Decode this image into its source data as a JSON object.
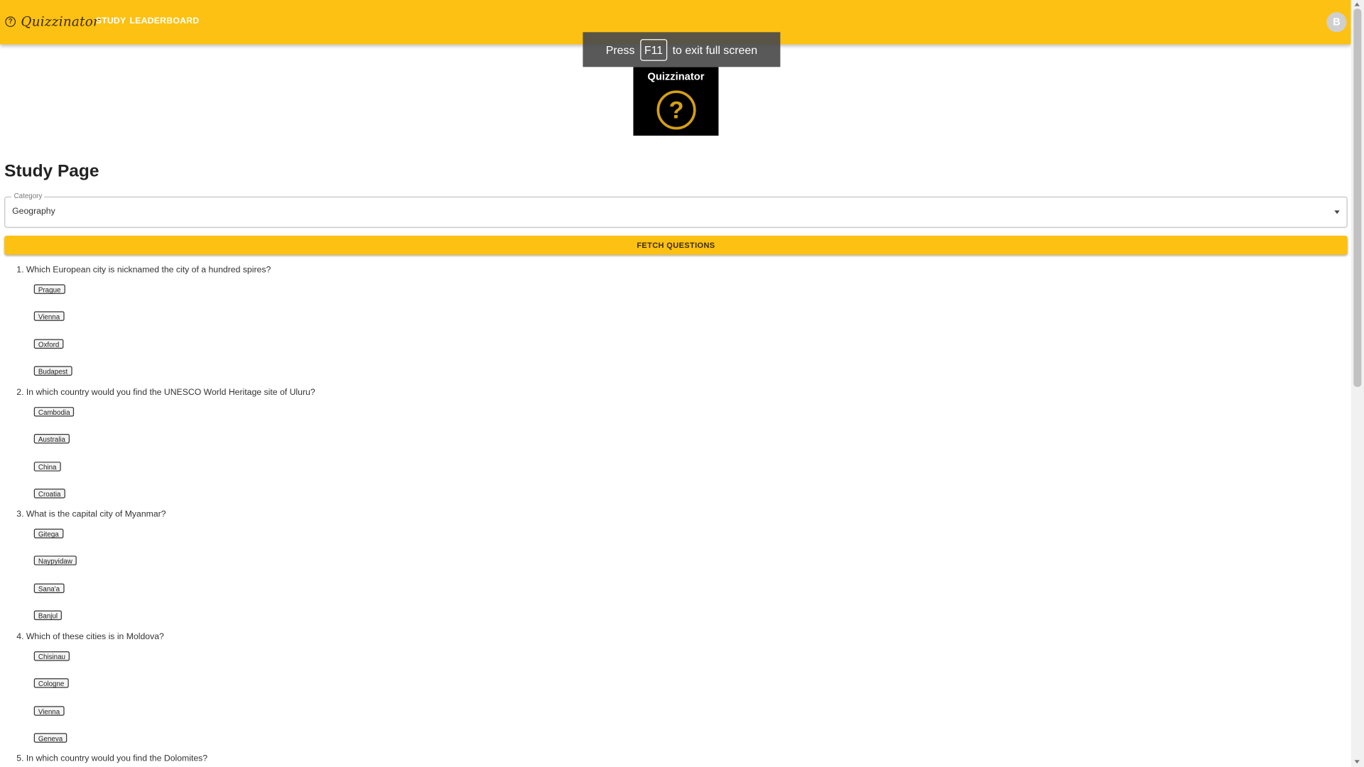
{
  "appbar": {
    "brand": "Quizzinator",
    "nav": [
      {
        "label": "STUDY"
      },
      {
        "label": "LEADERBOARD"
      }
    ],
    "avatar_initial": "B"
  },
  "fullscreen_banner": {
    "prefix": "Press",
    "key": "F11",
    "suffix": "to exit full screen"
  },
  "logo": {
    "title": "Quizzinator",
    "glyph": "?"
  },
  "page": {
    "title": "Study Page"
  },
  "category": {
    "label": "Category",
    "value": "Geography"
  },
  "fetch_button": "FETCH QUESTIONS",
  "questions": [
    {
      "text": "1. Which European city is nicknamed the city of a hundred spires?",
      "options": [
        "Prague",
        "Vienna",
        "Oxford",
        "Budapest"
      ]
    },
    {
      "text": "2. In which country would you find the UNESCO World Heritage site of Uluru?",
      "options": [
        "Cambodia",
        "Australia",
        "China",
        "Croatia"
      ]
    },
    {
      "text": "3. What is the capital city of Myanmar?",
      "options": [
        "Gitega",
        "Naypyidaw",
        "Sana'a",
        "Banjul"
      ]
    },
    {
      "text": "4. Which of these cities is in Moldova?",
      "options": [
        "Chisinau",
        "Cologne",
        "Vienna",
        "Geneva"
      ]
    },
    {
      "text": "5. In which country would you find the Dolomites?",
      "options": []
    }
  ],
  "colors": {
    "appbar": "#fdc113",
    "logo_bg": "#000000",
    "logo_accent": "#d4a017"
  }
}
